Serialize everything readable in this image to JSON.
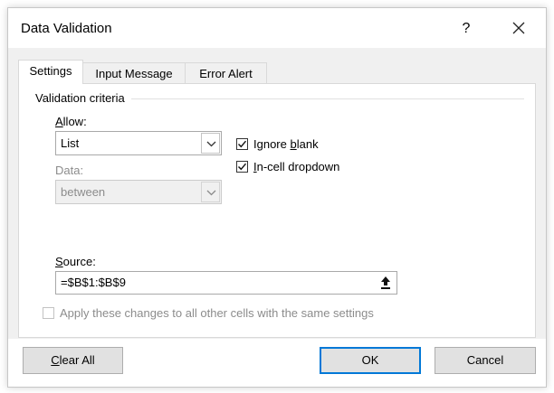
{
  "window": {
    "title": "Data Validation",
    "help_label": "?"
  },
  "tabs": [
    {
      "label": "Settings",
      "active": true
    },
    {
      "label": "Input Message",
      "active": false
    },
    {
      "label": "Error Alert",
      "active": false
    }
  ],
  "settings": {
    "section_label": "Validation criteria",
    "allow": {
      "label_pre": "",
      "label_key": "A",
      "label_post": "llow:",
      "value": "List"
    },
    "data": {
      "label": "Data:",
      "value": "between",
      "disabled": true
    },
    "source": {
      "label_key": "S",
      "label_post": "ource:",
      "value": "=$B$1:$B$9"
    },
    "ignore_blank": {
      "label_pre": "Ignore ",
      "label_key": "b",
      "label_post": "lank",
      "checked": true
    },
    "in_cell_dropdown": {
      "label_key": "I",
      "label_post": "n-cell dropdown",
      "checked": true
    },
    "apply_all": {
      "label": "Apply these changes to all other cells with the same settings",
      "checked": false,
      "disabled": true
    }
  },
  "buttons": {
    "clear_all_key": "C",
    "clear_all_post": "lear All",
    "ok": "OK",
    "cancel": "Cancel"
  },
  "icons": {
    "close": "close-icon",
    "dropdown": "chevron-down-icon",
    "collapse": "collapse-dialog-icon",
    "check": "checkmark-icon"
  }
}
